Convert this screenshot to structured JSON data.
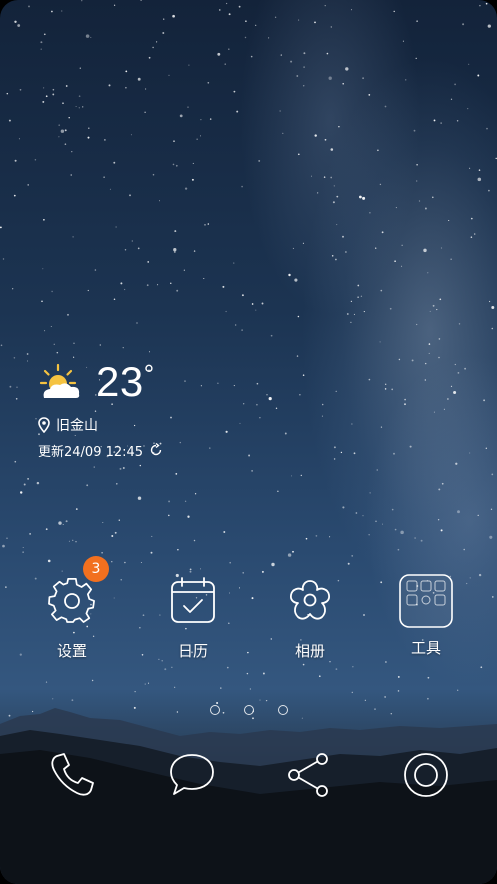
{
  "weather": {
    "icon": "partly-sunny-icon",
    "temperature": "23",
    "degree_symbol": "°",
    "location": "旧金山",
    "updated": "更新24/09 12:45"
  },
  "apps": [
    {
      "label": "设置",
      "icon": "gear-icon",
      "badge": "3"
    },
    {
      "label": "日历",
      "icon": "calendar-icon"
    },
    {
      "label": "相册",
      "icon": "flower-icon"
    },
    {
      "label": "工具",
      "icon": "tools-folder-icon"
    }
  ],
  "page_indicator": {
    "count": 3
  },
  "dock": [
    {
      "icon": "phone-icon"
    },
    {
      "icon": "message-icon"
    },
    {
      "icon": "share-icon"
    },
    {
      "icon": "camera-icon"
    }
  ],
  "colors": {
    "badge": "#f2701f",
    "sun": "#f5c341"
  }
}
